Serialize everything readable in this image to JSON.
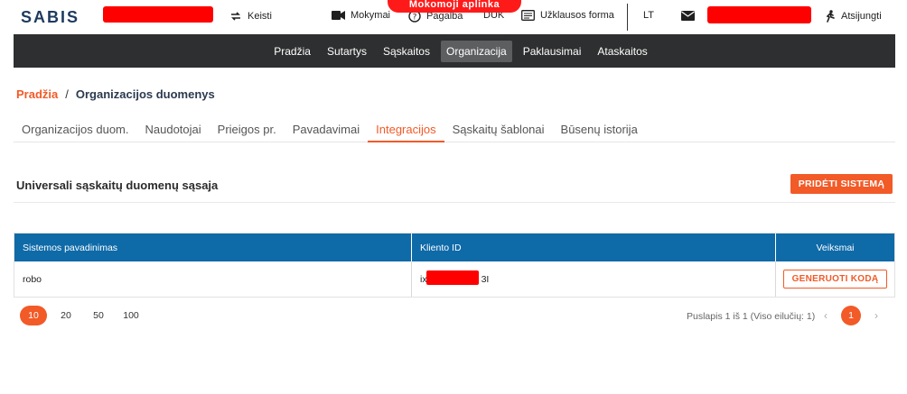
{
  "topbar": {
    "logo": "SABIS",
    "switch_label": "Keisti",
    "training_label": "Mokymai",
    "help_label": "Pagalba",
    "faq_label": "DUK",
    "request_form_label": "Užklausos forma",
    "language": "LT",
    "logout_label": "Atsijungti",
    "environment_label": "Mokomoji aplinka"
  },
  "nav": {
    "items": [
      {
        "label": "Pradžia"
      },
      {
        "label": "Sutartys"
      },
      {
        "label": "Sąskaitos"
      },
      {
        "label": "Organizacija"
      },
      {
        "label": "Paklausimai"
      },
      {
        "label": "Ataskaitos"
      }
    ],
    "active": "Organizacija"
  },
  "breadcrumb": {
    "home": "Pradžia",
    "separator": "/",
    "current": "Organizacijos duomenys"
  },
  "tabs": {
    "items": [
      {
        "label": "Organizacijos duom."
      },
      {
        "label": "Naudotojai"
      },
      {
        "label": "Prieigos pr."
      },
      {
        "label": "Pavadavimai"
      },
      {
        "label": "Integracijos"
      },
      {
        "label": "Sąskaitų šablonai"
      },
      {
        "label": "Būsenų istorija"
      }
    ],
    "active": "Integracijos"
  },
  "section": {
    "title": "Universali sąskaitų duomenų sąsaja",
    "add_button": "PRIDĖTI SISTEMĄ"
  },
  "table": {
    "headers": [
      "Sistemos pavadinimas",
      "Kliento ID",
      "Veiksmai"
    ],
    "rows": [
      {
        "name": "robo",
        "client_id_prefix": "ix",
        "client_id_suffix": "3I",
        "action": "GENERUOTI KODĄ"
      }
    ]
  },
  "pagination": {
    "page_sizes": [
      "10",
      "20",
      "50",
      "100"
    ],
    "selected_size": "10",
    "info": "Puslapis 1 iš 1 (Viso eilučių: 1)",
    "current_page": "1",
    "prev_arrow": "‹",
    "next_arrow": "›"
  },
  "colors": {
    "accent": "#f25a27",
    "nav_bg": "#2e2f30",
    "table_header": "#0f6aa8",
    "redaction": "#ff0000"
  }
}
